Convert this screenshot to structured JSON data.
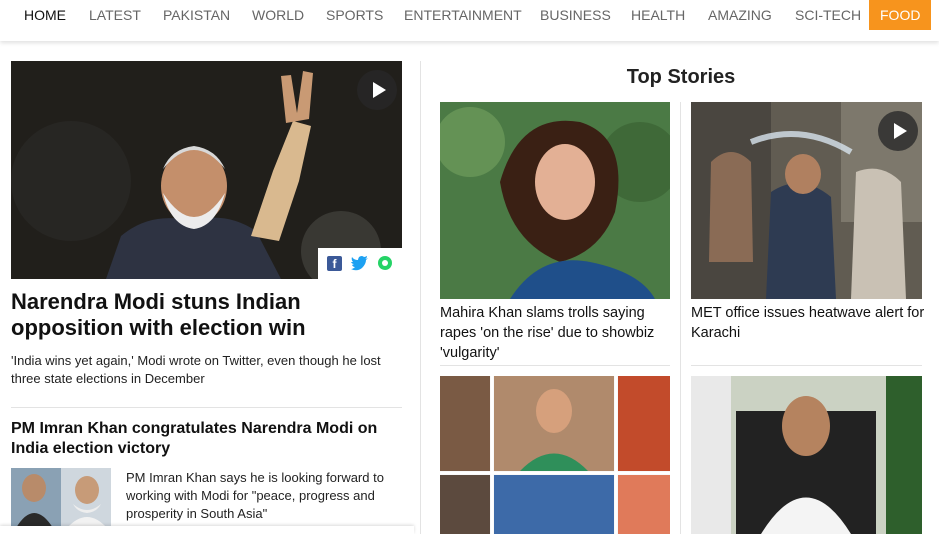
{
  "nav": {
    "items": [
      {
        "label": "HOME"
      },
      {
        "label": "LATEST"
      },
      {
        "label": "PAKISTAN"
      },
      {
        "label": "WORLD"
      },
      {
        "label": "SPORTS"
      },
      {
        "label": "ENTERTAINMENT"
      },
      {
        "label": "BUSINESS"
      },
      {
        "label": "HEALTH"
      },
      {
        "label": "AMAZING"
      },
      {
        "label": "SCI-TECH"
      },
      {
        "label": "FOOD"
      }
    ],
    "active": "HOME",
    "accent_color": "#f7941d"
  },
  "main": {
    "lead": {
      "headline": "Narendra Modi stuns Indian opposition with election win",
      "excerpt": "'India wins yet again,' Modi wrote on Twitter, even though he lost three state elections in December",
      "share_icons": [
        "facebook-icon",
        "twitter-icon",
        "whatsapp-icon"
      ],
      "has_video": true
    },
    "second": {
      "headline": "PM Imran Khan congratulates Narendra Modi on India election victory",
      "excerpt": "PM Imran Khan says he is looking forward to working with Modi for \"peace, progress and prosperity in South Asia\""
    }
  },
  "top_stories": {
    "title": "Top Stories",
    "items": [
      {
        "headline": "Mahira Khan slams trolls saying rapes 'on the rise' due to showbiz 'vulgarity'"
      },
      {
        "headline": "MET office issues heatwave alert for Karachi",
        "has_video": true
      }
    ]
  }
}
